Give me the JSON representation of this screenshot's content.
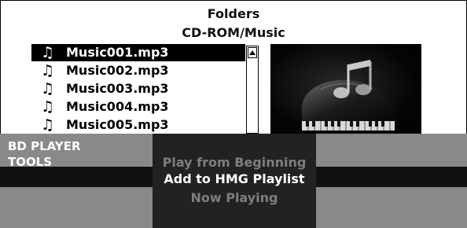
{
  "header": {
    "title": "Folders",
    "path": "CD-ROM/Music"
  },
  "file_list": {
    "items": [
      {
        "icon": "music-note-icon",
        "name": "Music001.mp3",
        "selected": true
      },
      {
        "icon": "music-note-icon",
        "name": "Music002.mp3",
        "selected": false
      },
      {
        "icon": "music-note-icon",
        "name": "Music003.mp3",
        "selected": false
      },
      {
        "icon": "music-note-icon",
        "name": "Music004.mp3",
        "selected": false
      },
      {
        "icon": "music-note-icon",
        "name": "Music005.mp3",
        "selected": false
      }
    ]
  },
  "tools": {
    "title": "BD PLAYER\nTOOLS",
    "menu": [
      {
        "label": "Play from Beginning",
        "state": "dim"
      },
      {
        "label": "Add to HMG Playlist",
        "state": "active"
      },
      {
        "label": "Now Playing",
        "state": "dim"
      }
    ]
  },
  "colors": {
    "selection": "#000000",
    "tools_background": "#898989",
    "menu_background": "#222222",
    "active_line": "#111111"
  }
}
